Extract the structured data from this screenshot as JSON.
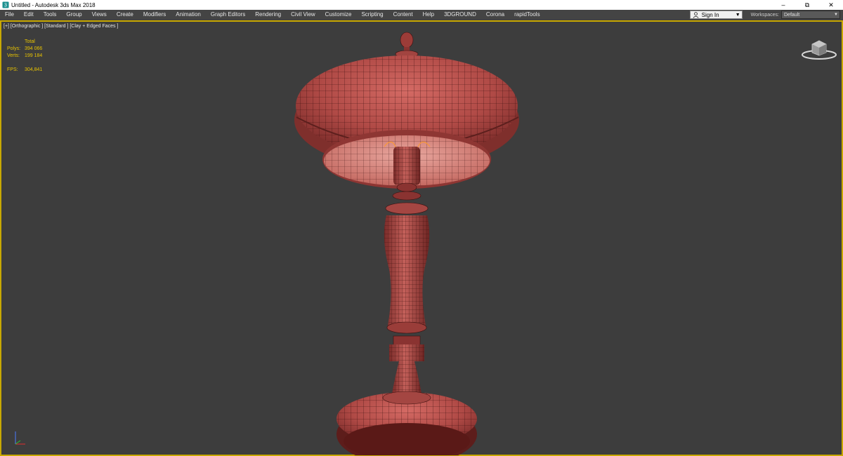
{
  "window": {
    "title": "Untitled - Autodesk 3ds Max 2018"
  },
  "menu": {
    "items": [
      "File",
      "Edit",
      "Tools",
      "Group",
      "Views",
      "Create",
      "Modifiers",
      "Animation",
      "Graph Editors",
      "Rendering",
      "Civil View",
      "Customize",
      "Scripting",
      "Content",
      "Help",
      "3DGROUND",
      "Corona",
      "rapidTools"
    ]
  },
  "signin": {
    "label": "Sign In"
  },
  "workspaces": {
    "label": "Workspaces:",
    "value": "Default"
  },
  "viewport": {
    "label": "[+] [Orthographic ] [Standard ] [Clay + Edged Faces ]",
    "stats": {
      "header": "Total",
      "polys_label": "Polys:",
      "polys_value": "394 066",
      "verts_label": "Verts:",
      "verts_value": "199 184",
      "fps_label": "FPS:",
      "fps_value": "304,841"
    }
  },
  "colors": {
    "viewport_border": "#c8a800",
    "stats_text": "#e8c300",
    "model_clay": "#b04a46",
    "background": "#3d3d3d"
  }
}
